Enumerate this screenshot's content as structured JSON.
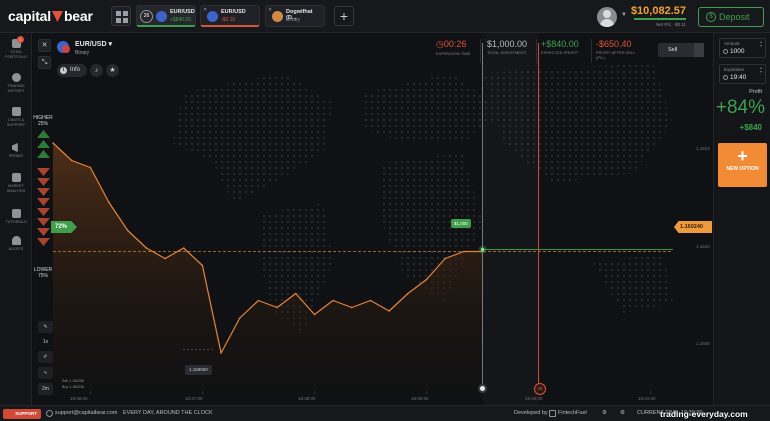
{
  "brand": {
    "name_left": "capital",
    "name_right": "bear"
  },
  "tabs": [
    {
      "timer": "26",
      "name": "EUR/USD",
      "sub": "+$840.00",
      "sub_color": "#3fa14f"
    },
    {
      "timer": "",
      "name": "EUR/USD",
      "sub": "-$0.10",
      "sub_color": "#d4583f"
    },
    {
      "timer": "",
      "name": "Dogwifhat (D...",
      "sub": "Binary",
      "sub_color": "#8d929b"
    }
  ],
  "account": {
    "balance": "$10,082.57",
    "sub": "Net P/L: -$0.11"
  },
  "deposit": {
    "label": "Deposit"
  },
  "leftnav": [
    {
      "label": "TOTAL PORTFOLIO",
      "badge": "1"
    },
    {
      "label": "TRADING HISTORY",
      "badge": ""
    },
    {
      "label": "CHATS & SUPPORT",
      "badge": ""
    },
    {
      "label": "PROMO",
      "badge": ""
    },
    {
      "label": "MARKET ANALYSIS",
      "badge": ""
    },
    {
      "label": "TUTORIALS",
      "badge": ""
    },
    {
      "label": "ALERTS",
      "badge": ""
    }
  ],
  "asset": {
    "name": "EUR/USD",
    "type": "Binary"
  },
  "info": {
    "label": "Info"
  },
  "stats": {
    "expiration": {
      "value": "00:26",
      "label": "EXPIRATION TIME"
    },
    "investment": {
      "value": "$1,000.00",
      "label": "TOTAL INVESTMENT"
    },
    "expected": {
      "value": "+$840.00",
      "label": "EXPECTED PROFIT"
    },
    "pl": {
      "value": "-$650.40",
      "label": "PROFIT AFTER SELL (P/L)"
    }
  },
  "sell": {
    "label": "Sell"
  },
  "sentiment": {
    "higher_label": "HIGHER",
    "higher_pct": "25%",
    "lower_label": "LOWER",
    "lower_pct": "75%",
    "current_pct": "72%"
  },
  "chart": {
    "current_price": "1.160240",
    "min_price": "1.159960",
    "amount_bubble": "$1,000",
    "y_ticks": [
      "1.1604",
      "1.1602",
      "1.1600"
    ],
    "x_ticks": [
      "19:36:00",
      "19:37:00",
      "19:38:00",
      "19:39:00",
      "19:40:00",
      "19:41:00"
    ],
    "timer_marker": "26",
    "orderbook": [
      "Sell 1.160258",
      "Buy 1.160238"
    ]
  },
  "chart_data": {
    "type": "line",
    "x": [
      "19:35:40",
      "19:35:50",
      "19:36:00",
      "19:36:10",
      "19:36:20",
      "19:36:30",
      "19:36:40",
      "19:36:50",
      "19:37:00",
      "19:37:10",
      "19:37:20",
      "19:37:30",
      "19:37:40",
      "19:37:50",
      "19:38:00",
      "19:38:10",
      "19:38:20",
      "19:38:30",
      "19:38:40",
      "19:38:50",
      "19:39:00",
      "19:39:10",
      "19:39:20",
      "19:39:30"
    ],
    "series": [
      {
        "values": [
          1.16055,
          1.1605,
          1.16048,
          1.16038,
          1.1603,
          1.16025,
          1.16022,
          1.16025,
          1.1602,
          1.15995,
          1.16005,
          1.1601,
          1.16008,
          1.16012,
          1.16006,
          1.1601,
          1.16008,
          1.1601,
          1.16007,
          1.16012,
          1.16016,
          1.16022,
          1.16024,
          1.16024
        ]
      }
    ],
    "ylim": [
      1.15985,
      1.16075
    ],
    "xlim": [
      "19:35:40",
      "19:41:20"
    ],
    "grid": false,
    "x_ticks": [
      "19:36:00",
      "19:37:00",
      "19:38:00",
      "19:39:00",
      "19:40:00",
      "19:41:00"
    ],
    "y_ticks": [
      1.1604,
      1.1602,
      1.16
    ],
    "current_price": 1.16024,
    "min_price": 1.15996,
    "price_line_color": "#ef9a3c",
    "entry_line_color": "#3fa14f",
    "area_color": "#4a2d17"
  },
  "right": {
    "amount_label": "Amount",
    "amount_value": "1000",
    "expiration_label": "Expiration",
    "expiration_value": "19:40",
    "profit_label": "Profit",
    "profit_pct": "+84%",
    "profit_amount": "+$840",
    "new_option": "NEW OPTION"
  },
  "chart_tools": {
    "timeframe": "1x",
    "period": "2m"
  },
  "footer": {
    "support": "SUPPORT",
    "email": "support@capitalbear.com",
    "tagline": "EVERY DAY, AROUND THE CLOCK",
    "developed_by": "Developed by",
    "dev_name": "FintechFuel",
    "current_time_label": "CURRENT TIME:",
    "current_time": "19:39:30",
    "watermark": "trading-everyday.com"
  },
  "colors": {
    "accent_green": "#3fa14f",
    "accent_orange": "#f28b35",
    "accent_red": "#d4583f"
  }
}
